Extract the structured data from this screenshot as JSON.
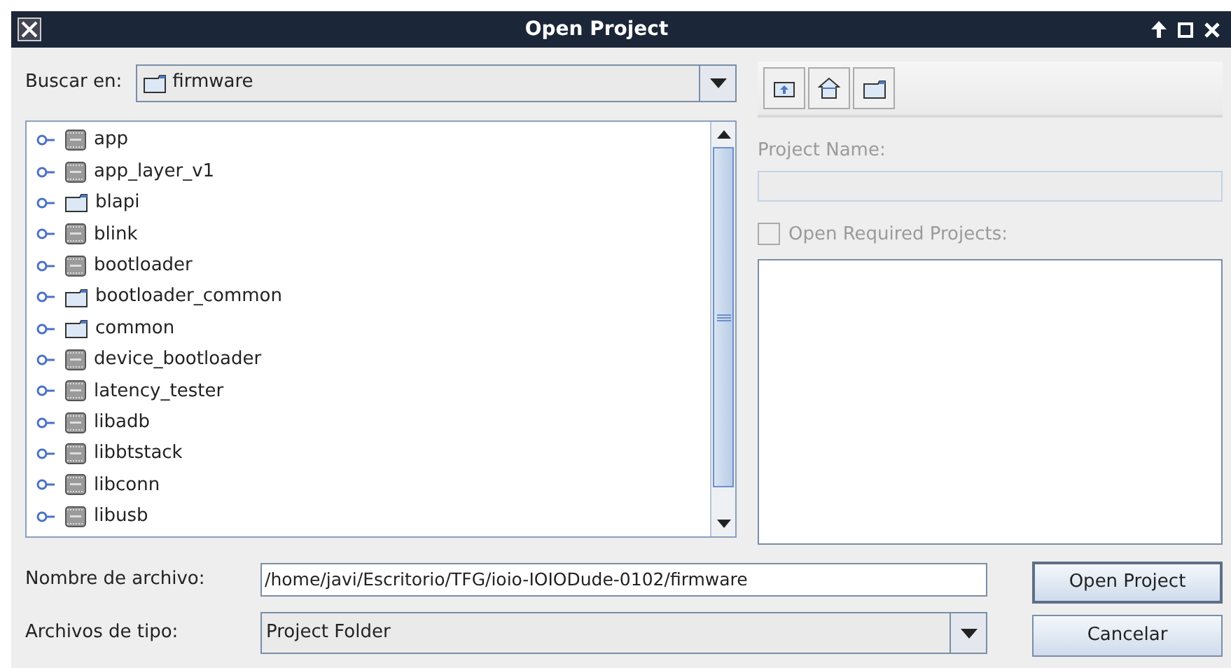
{
  "window": {
    "title": "Open Project"
  },
  "look_in": {
    "label": "Buscar en:",
    "value": "firmware"
  },
  "tree": {
    "items": [
      {
        "name": "app",
        "kind": "project"
      },
      {
        "name": "app_layer_v1",
        "kind": "project"
      },
      {
        "name": "blapi",
        "kind": "folder"
      },
      {
        "name": "blink",
        "kind": "project"
      },
      {
        "name": "bootloader",
        "kind": "project"
      },
      {
        "name": "bootloader_common",
        "kind": "folder"
      },
      {
        "name": "common",
        "kind": "folder"
      },
      {
        "name": "device_bootloader",
        "kind": "project"
      },
      {
        "name": "latency_tester",
        "kind": "project"
      },
      {
        "name": "libadb",
        "kind": "project"
      },
      {
        "name": "libbtstack",
        "kind": "project"
      },
      {
        "name": "libconn",
        "kind": "project"
      },
      {
        "name": "libusb",
        "kind": "project"
      }
    ]
  },
  "project_name": {
    "label": "Project Name:",
    "disabled": true
  },
  "open_required": {
    "label": "Open Required Projects:",
    "checked": false,
    "disabled": true
  },
  "file_name": {
    "label": "Nombre de archivo:",
    "value": "/home/javi/Escritorio/TFG/ioio-IOIODude-0102/firmware"
  },
  "file_type": {
    "label": "Archivos de tipo:",
    "value": "Project Folder"
  },
  "buttons": [
    {
      "label": "Open Project",
      "default": true
    },
    {
      "label": "Cancelar",
      "default": false
    }
  ]
}
